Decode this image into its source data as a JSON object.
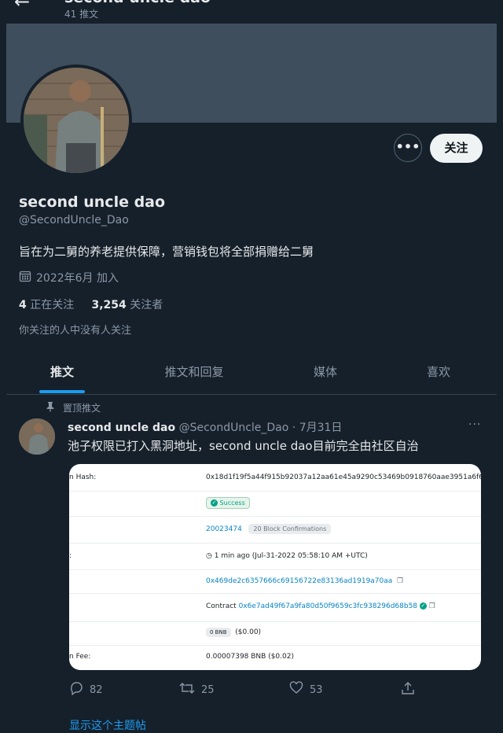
{
  "header": {
    "title": "second uncle dao",
    "tweet_count": "41 推文"
  },
  "profile": {
    "display_name": "second uncle dao",
    "handle": "@SecondUncle_Dao",
    "bio": "旨在为二舅的养老提供保障，营销钱包将全部捐赠给二舅",
    "joined": "2022年6月 加入",
    "following_count": "4",
    "following_label": "正在关注",
    "followers_count": "3,254",
    "followers_label": "关注者",
    "followers_you_know": "你关注的人中没有人关注",
    "follow_button": "关注",
    "more_button": "•••"
  },
  "tabs": [
    {
      "label": "推文",
      "active": true
    },
    {
      "label": "推文和回复",
      "active": false
    },
    {
      "label": "媒体",
      "active": false
    },
    {
      "label": "喜欢",
      "active": false
    }
  ],
  "tweet": {
    "pinned_label": "置顶推文",
    "author_name": "second uncle dao",
    "author_handle": "@SecondUncle_Dao",
    "date": "· 7月31日",
    "more": "···",
    "text": "池子权限已打入黑洞地址，second uncle dao目前完全由社区自治",
    "replies": "82",
    "retweets": "25",
    "likes": "53"
  },
  "card": {
    "rows": [
      {
        "label": "n Hash:",
        "value": "0x18d1f19f5a44f915b92037a12aa61e45a9290c53469b0918760aae3951a6f631"
      },
      {
        "label": "",
        "status": "Success"
      },
      {
        "label": "",
        "block": "20023474",
        "confirmations": "20 Block Confirmations"
      },
      {
        "label": ":",
        "time": "1 min ago (Jul-31-2022 05:58:10 AM +UTC)"
      },
      {
        "label": "",
        "from": "0x469de2c6357666c69156722e83136ad1919a70aa"
      },
      {
        "label": "",
        "contract_prefix": "Contract",
        "contract": "0x6e7ad49f67a9fa80d50f9659c3fc938296d68b58"
      },
      {
        "label": "",
        "value_bnb": "0 BNB",
        "value_usd": "($0.00)"
      },
      {
        "label": "n Fee:",
        "fee": "0.00007398 BNB ($0.02)"
      }
    ]
  },
  "bottom_link": "显示这个主题帖"
}
